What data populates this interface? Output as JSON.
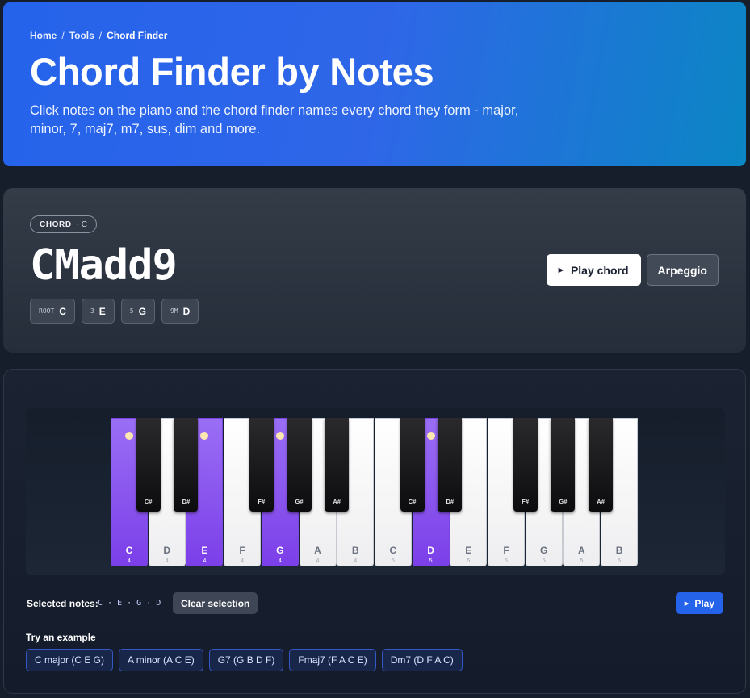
{
  "breadcrumb": {
    "home": "Home",
    "tools": "Tools",
    "current": "Chord Finder",
    "separator": "/"
  },
  "hero": {
    "title": "Chord Finder by Notes",
    "subtitle": "Click notes on the piano and the chord finder names every chord they form - major, minor, 7, maj7, m7, sus, dim and more."
  },
  "chord": {
    "chip_label": "CHORD",
    "chip_root": "· C",
    "name": "CMadd9",
    "intervals": [
      {
        "label": "ROOT",
        "note": "C"
      },
      {
        "label": "3",
        "note": "E"
      },
      {
        "label": "5",
        "note": "G"
      },
      {
        "label": "9M",
        "note": "D"
      }
    ],
    "play_label": "Play chord",
    "arpeggio_label": "Arpeggio"
  },
  "keyboard": {
    "white_keys": [
      {
        "note": "C",
        "octave": "4",
        "selected": true
      },
      {
        "note": "D",
        "octave": "4",
        "selected": false
      },
      {
        "note": "E",
        "octave": "4",
        "selected": true
      },
      {
        "note": "F",
        "octave": "4",
        "selected": false
      },
      {
        "note": "G",
        "octave": "4",
        "selected": true
      },
      {
        "note": "A",
        "octave": "4",
        "selected": false
      },
      {
        "note": "B",
        "octave": "4",
        "selected": false
      },
      {
        "note": "C",
        "octave": "5",
        "selected": false
      },
      {
        "note": "D",
        "octave": "5",
        "selected": true
      },
      {
        "note": "E",
        "octave": "5",
        "selected": false
      },
      {
        "note": "F",
        "octave": "5",
        "selected": false
      },
      {
        "note": "G",
        "octave": "5",
        "selected": false
      },
      {
        "note": "A",
        "octave": "5",
        "selected": false
      },
      {
        "note": "B",
        "octave": "5",
        "selected": false
      }
    ],
    "black_keys": [
      "C#",
      "D#",
      "F#",
      "G#",
      "A#",
      "C#",
      "D#",
      "F#",
      "G#",
      "A#"
    ]
  },
  "selection": {
    "label": "Selected notes:",
    "notes": "C · E · G · D",
    "clear_label": "Clear selection",
    "play_label": "Play"
  },
  "examples": {
    "label": "Try an example",
    "items": [
      "C major (C E G)",
      "A minor (A C E)",
      "G7 (G B D F)",
      "Fmaj7 (F A C E)",
      "Dm7 (D F A C)"
    ]
  }
}
